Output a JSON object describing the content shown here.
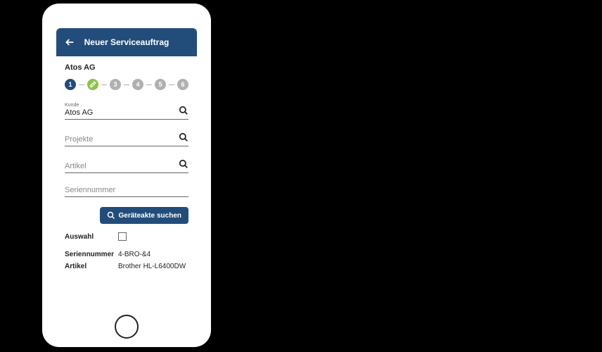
{
  "header": {
    "title": "Neuer Serviceauftrag"
  },
  "company": "Atos AG",
  "steps": [
    "1",
    "",
    "3",
    "4",
    "5",
    "6"
  ],
  "fields": {
    "kunde": {
      "label": "Kunde",
      "value": "Atos AG"
    },
    "projekte": {
      "placeholder": "Projekte"
    },
    "artikel": {
      "placeholder": "Artikel"
    },
    "seriennummer": {
      "placeholder": "Seriennummer"
    }
  },
  "searchButton": "Geräteakte suchen",
  "result": {
    "auswahl_label": "Auswahl",
    "seriennummer_label": "Seriennummer",
    "seriennummer_value": "4-BRO-&4",
    "artikel_label": "Artikel",
    "artikel_value": "Brother HL-L6400DW"
  }
}
